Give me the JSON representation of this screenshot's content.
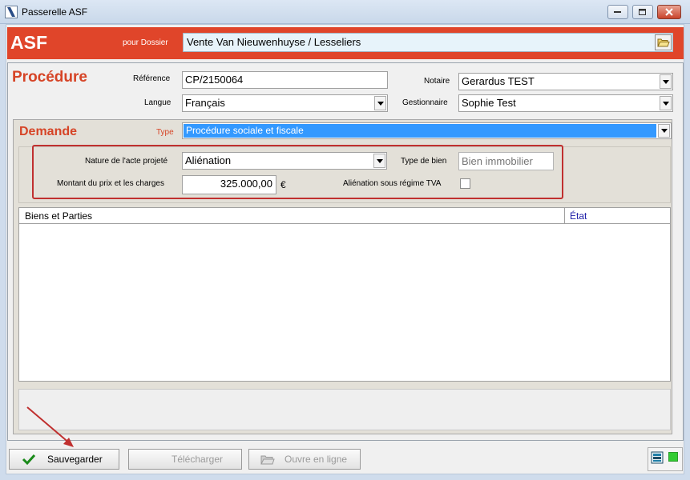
{
  "window": {
    "title": "Passerelle ASF"
  },
  "header": {
    "app_name": "ASF",
    "dossier_label": "pour Dossier",
    "dossier_value": "Vente Van Nieuwenhuyse / Lesseliers"
  },
  "procedure": {
    "title": "Procédure",
    "reference_label": "Référence",
    "reference_value": "CP/2150064",
    "langue_label": "Langue",
    "langue_value": "Français",
    "notaire_label": "Notaire",
    "notaire_value": "Gerardus TEST",
    "gestionnaire_label": "Gestionnaire",
    "gestionnaire_value": "Sophie Test"
  },
  "demande": {
    "title": "Demande",
    "type_label": "Type",
    "type_value": "Procédure sociale et fiscale",
    "nature_label": "Nature de l'acte projeté",
    "nature_value": "Aliénation",
    "type_bien_label": "Type de bien",
    "type_bien_placeholder": "Bien immobilier",
    "montant_label": "Montant du prix et les charges",
    "montant_value": "325.000,00",
    "currency": "€",
    "tva_label": "Aliénation sous régime TVA"
  },
  "list": {
    "columns": [
      "Biens et Parties",
      "État"
    ]
  },
  "buttons": {
    "save": "Sauvegarder",
    "download": "Télécharger",
    "open_online": "Ouvre en ligne"
  },
  "colors": {
    "accent": "#e0452a",
    "selection": "#3399ff",
    "annotation_red": "#c0302f",
    "status_green": "#33cc33"
  }
}
